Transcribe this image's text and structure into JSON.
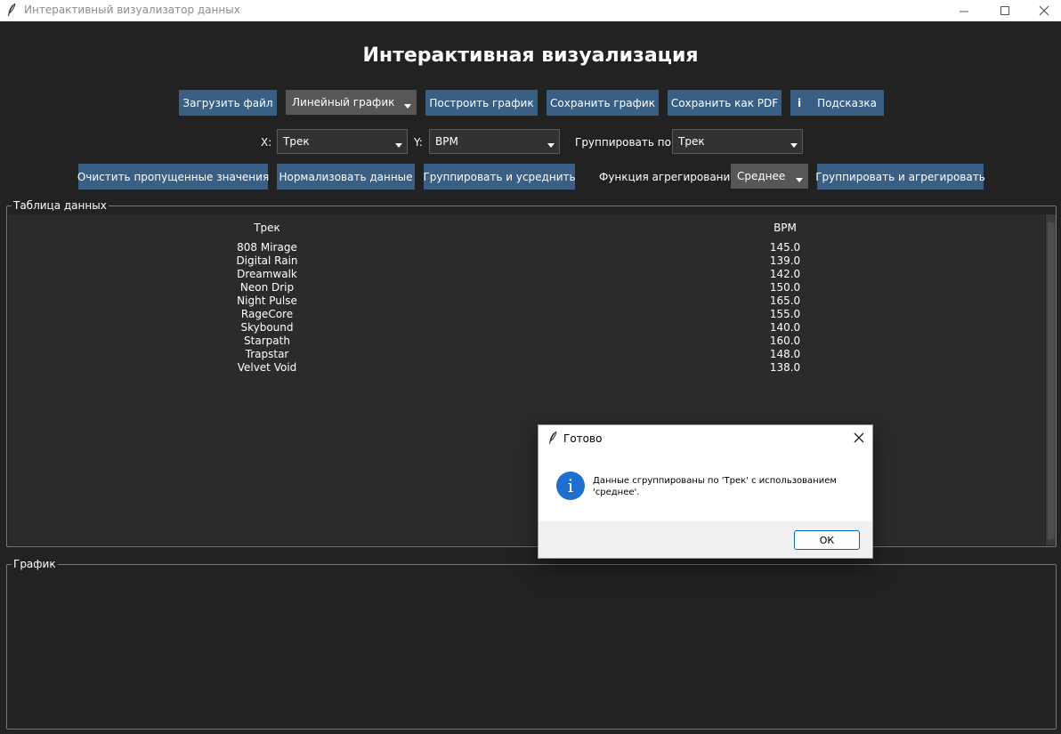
{
  "window": {
    "title": "Интерактивный визуализатор данных"
  },
  "main_title": "Интерактивная визуализация",
  "toolbar": {
    "load_file": "Загрузить файл",
    "chart_type": "Линейный график",
    "build_chart": "Построить график",
    "save_chart": "Сохранить график",
    "save_pdf": "Сохранить как PDF",
    "hint_icon_glyph": "i",
    "hint": "Подсказка"
  },
  "axes": {
    "x_label": "X:",
    "x_value": "Трек",
    "y_label": "Y:",
    "y_value": "BPM",
    "group_label": "Группировать по:",
    "group_value": "Трек"
  },
  "actions": {
    "clean_missing": "Очистить пропущенные значения",
    "normalize": "Нормализовать данные",
    "group_avg": "Группировать и усреднить",
    "agg_func_label": "Функция агрегирования:",
    "agg_func_value": "Среднее",
    "group_agg": "Группировать и агрегировать"
  },
  "table": {
    "group_title": "Таблица данных",
    "columns": [
      "Трек",
      "BPM"
    ],
    "rows": [
      [
        "808 Mirage",
        "145.0"
      ],
      [
        "Digital Rain",
        "139.0"
      ],
      [
        "Dreamwalk",
        "142.0"
      ],
      [
        "Neon Drip",
        "150.0"
      ],
      [
        "Night Pulse",
        "165.0"
      ],
      [
        "RageCore",
        "155.0"
      ],
      [
        "Skybound",
        "140.0"
      ],
      [
        "Starpath",
        "160.0"
      ],
      [
        "Trapstar",
        "148.0"
      ],
      [
        "Velvet Void",
        "138.0"
      ]
    ]
  },
  "chart_panel": {
    "group_title": "График"
  },
  "dialog": {
    "title": "Готово",
    "info_glyph": "i",
    "message": "Данные сгруппированы по 'Трек' с использованием 'среднее'.",
    "ok": "ОК"
  },
  "colors": {
    "background": "#222222",
    "button": "#3a5f85",
    "combo_dark": "#323232",
    "combo_grey": "#575757",
    "info_icon": "#1f6fce"
  }
}
